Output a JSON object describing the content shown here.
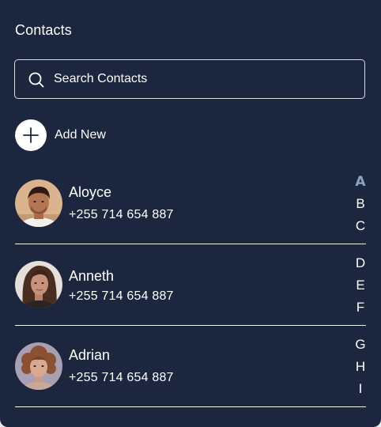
{
  "header": {
    "title": "Contacts"
  },
  "search": {
    "placeholder": "Search Contacts",
    "value": ""
  },
  "add_new": {
    "label": "Add New"
  },
  "contacts": [
    {
      "name": "Aloyce",
      "phone": "+255 714 654 887"
    },
    {
      "name": "Anneth",
      "phone": "+255 714 654 887"
    },
    {
      "name": "Adrian",
      "phone": "+255 714 654 887"
    }
  ],
  "alphabet": [
    "A",
    "B",
    "C",
    "D",
    "E",
    "F",
    "G",
    "H",
    "I"
  ],
  "alphabet_active": "A",
  "colors": {
    "background": "#1c263e",
    "text": "#ffffff",
    "active_letter": "#8ea3c4"
  }
}
